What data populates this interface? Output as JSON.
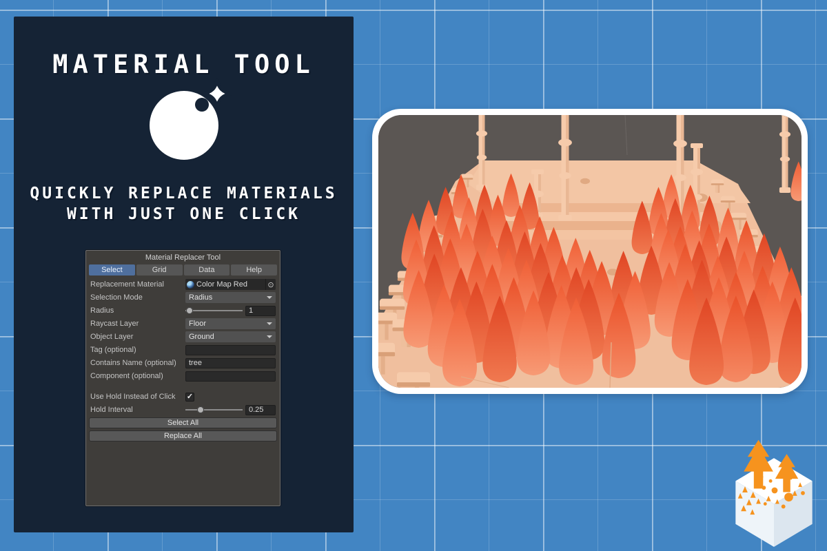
{
  "hero": {
    "title": "MATERIAL TOOL",
    "tagline_line1": "QUICKLY REPLACE MATERIALS",
    "tagline_line2": "WITH JUST ONE CLICK"
  },
  "tool_window": {
    "title": "Material Replacer Tool",
    "tabs": [
      {
        "label": "Select",
        "active": true
      },
      {
        "label": "Grid",
        "active": false
      },
      {
        "label": "Data",
        "active": false
      },
      {
        "label": "Help",
        "active": false
      }
    ],
    "fields": {
      "replacement_material": {
        "label": "Replacement Material",
        "value": "Color Map Red"
      },
      "selection_mode": {
        "label": "Selection Mode",
        "value": "Radius"
      },
      "radius": {
        "label": "Radius",
        "value": "1"
      },
      "raycast_layer": {
        "label": "Raycast Layer",
        "value": "Floor"
      },
      "object_layer": {
        "label": "Object Layer",
        "value": "Ground"
      },
      "tag": {
        "label": "Tag (optional)",
        "value": ""
      },
      "contains_name": {
        "label": "Contains Name (optional)",
        "value": "tree"
      },
      "component": {
        "label": "Component (optional)",
        "value": ""
      },
      "use_hold": {
        "label": "Use Hold Instead of Click",
        "checked": true
      },
      "hold_interval": {
        "label": "Hold Interval",
        "value": "0.25"
      }
    },
    "buttons": {
      "select_all": "Select All",
      "replace_all": "Replace All"
    }
  },
  "icons": {
    "check": "✓",
    "object_picker": "⊙"
  },
  "colors": {
    "background_blue": "#4285c3",
    "panel_navy": "#152335",
    "unity_panel": "#3f3d3a",
    "tab_active_blue": "#4f6f9e",
    "scene_background": "#5b5653",
    "ground_peach": "#f0bf9e",
    "platform_peach": "#f3c6a5",
    "post_light": "#f6cbab",
    "post_shade": "#d9a078",
    "tree_red_top": "#e84e28",
    "tree_red_bottom": "#f58a64",
    "accent_orange": "#f6931e"
  }
}
